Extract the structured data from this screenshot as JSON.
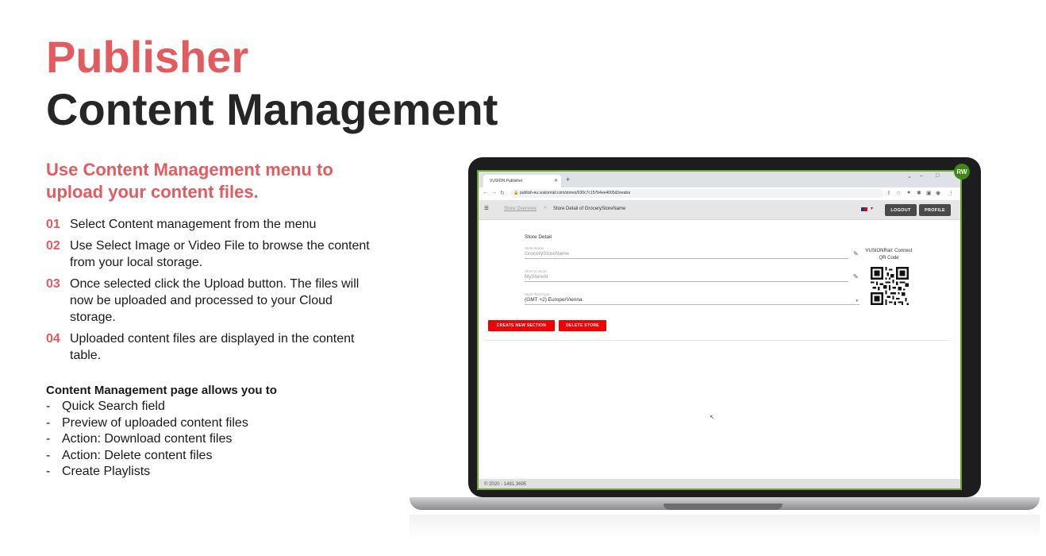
{
  "slide": {
    "title_line1": "Publisher",
    "title_line2": "Content Management",
    "subtitle": "Use Content Management menu to upload your content files.",
    "steps": [
      {
        "num": "01",
        "text": "Select Content management from the menu"
      },
      {
        "num": "02",
        "text": "Use Select Image or Video File to browse the content from your local storage."
      },
      {
        "num": "03",
        "text": "Once selected click the Upload button. The files will now be uploaded and processed to your Cloud storage."
      },
      {
        "num": "04",
        "text": "Uploaded content files are displayed in the content table."
      }
    ],
    "allows_heading": "Content Management page allows you to",
    "allows_dash": "-",
    "allows_items": [
      "Quick Search field",
      "Preview of uploaded content files",
      "Action: Download content files",
      "Action: Delete content files",
      "Create Playlists"
    ],
    "accent_color": "#e35b5f"
  },
  "screenshot": {
    "badge": "RW",
    "browser": {
      "tab_title": "VUSION Publisher",
      "url": "publish-eu.vusionrail.com/stores/630c7c157b4ee4005d2eeaba"
    },
    "header": {
      "breadcrumb_link": "Store Overview",
      "breadcrumb_sep": ">",
      "breadcrumb_current": "Store Detail of GroceryStoreName",
      "logout_label": "LOGOUT",
      "profile_label": "PROFILE"
    },
    "detail": {
      "section_title": "Store Detail",
      "fields": [
        {
          "label": "Store Name",
          "value": "GroceryStoreName"
        },
        {
          "label": "Store In Store",
          "value": "MyStoreId"
        },
        {
          "label": "Store Timezone",
          "value": "(GMT +2) Europe/Vienna"
        }
      ],
      "qr_label": "VUSIONRail: Connect QR Code",
      "create_section_label": "CREATE NEW SECTION",
      "delete_store_label": "DELETE STORE"
    },
    "footer": "© 2020 - 1481.3695",
    "primary_button_color": "#f50000"
  }
}
